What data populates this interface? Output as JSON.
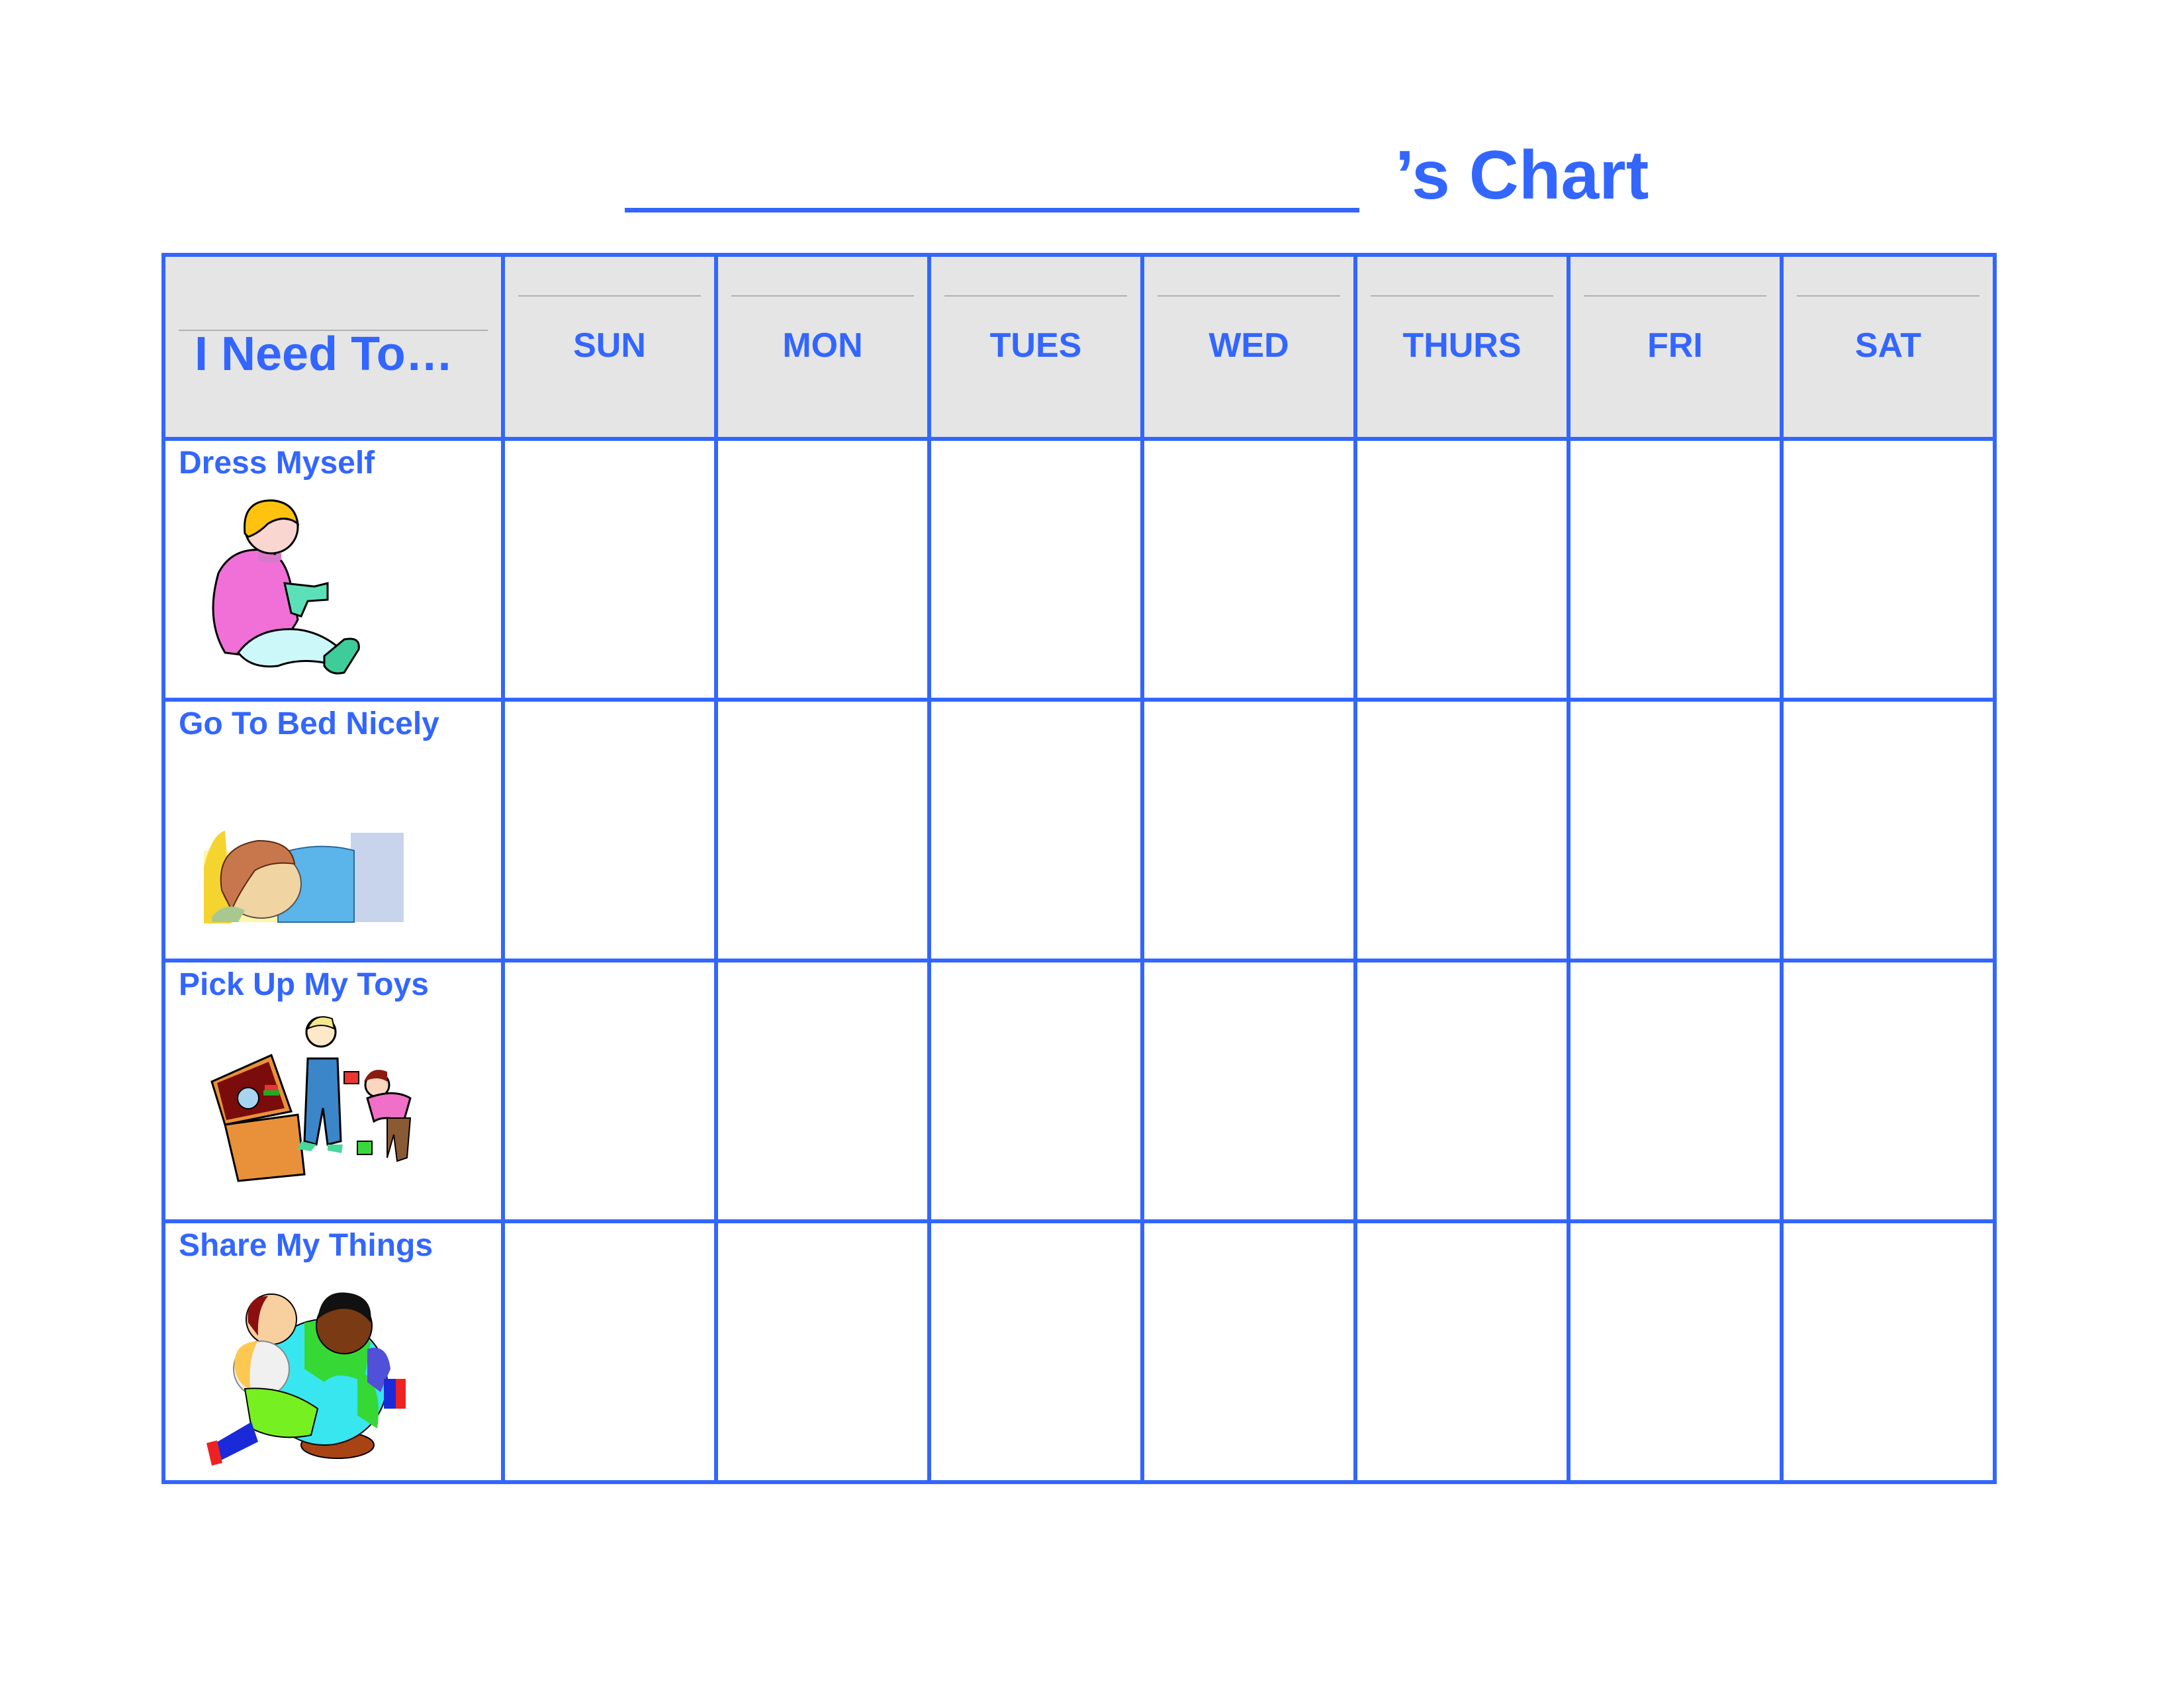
{
  "title": {
    "name_blank": "",
    "suffix": "’s Chart"
  },
  "colors": {
    "accent": "#3366ff",
    "header_bg": "#e5e5e5",
    "header_rule": "#b0b0b0"
  },
  "table": {
    "task_header": "I Need To…",
    "days": [
      "SUN",
      "MON",
      "TUES",
      "WED",
      "THURS",
      "FRI",
      "SAT"
    ],
    "tasks": [
      {
        "label": "Dress Myself",
        "icon": "child-dressing-icon"
      },
      {
        "label": "Go To Bed Nicely",
        "icon": "child-sleeping-icon"
      },
      {
        "label": "Pick Up My Toys",
        "icon": "children-toybox-icon"
      },
      {
        "label": "Share My Things",
        "icon": "children-hugging-globe-icon"
      }
    ]
  }
}
